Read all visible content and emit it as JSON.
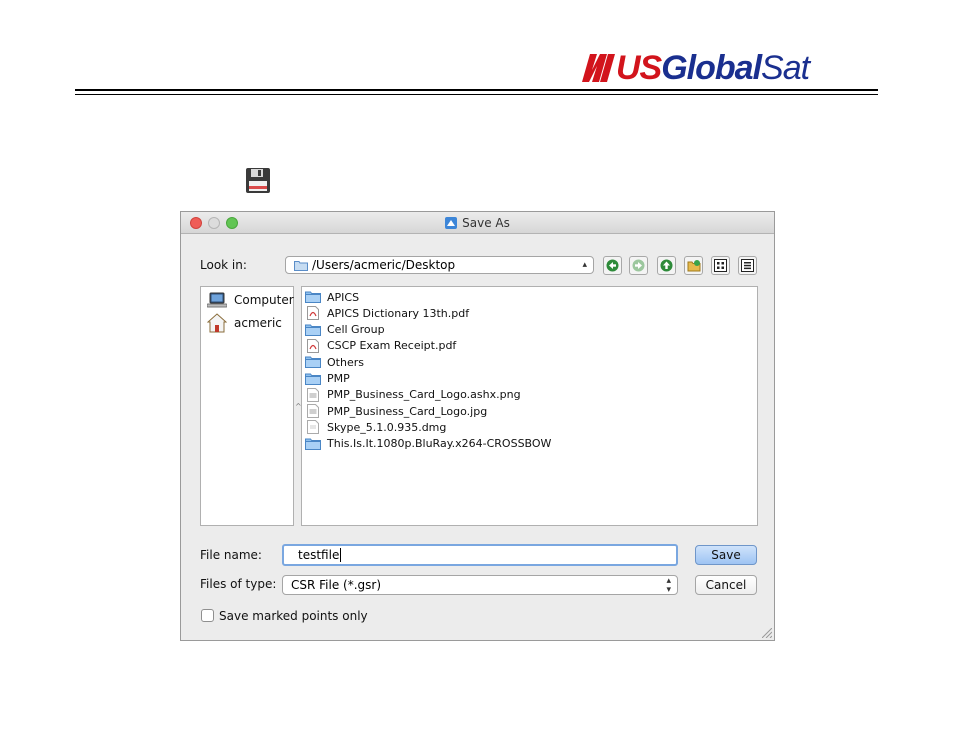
{
  "brand": {
    "logo_prefix": "US",
    "logo_suffix_1": "Global",
    "logo_suffix_2": "Sat",
    "colors": {
      "red": "#d2141c",
      "blue": "#1a2f8f"
    }
  },
  "page_icons": {
    "floppy": "floppy-disk-icon"
  },
  "dialog": {
    "title": "Save As",
    "title_icon": "save-as-icon",
    "window_buttons": [
      "close",
      "minimize",
      "zoom"
    ],
    "look_in_label": "Look in:",
    "look_in_value": "/Users/acmeric/Desktop",
    "toolbar_icons": [
      "back-icon",
      "forward-icon",
      "parent-folder-icon",
      "new-folder-icon",
      "list-view-icon",
      "detail-view-icon"
    ],
    "places": [
      {
        "label": "Computer",
        "icon": "computer-icon"
      },
      {
        "label": "acmeric",
        "icon": "home-icon"
      }
    ],
    "files": [
      {
        "name": "APICS",
        "icon": "folder-icon"
      },
      {
        "name": "APICS Dictionary 13th.pdf",
        "icon": "pdf-icon"
      },
      {
        "name": "Cell Group",
        "icon": "folder-icon"
      },
      {
        "name": "CSCP Exam Receipt.pdf",
        "icon": "pdf-icon"
      },
      {
        "name": "Others",
        "icon": "folder-icon"
      },
      {
        "name": "PMP",
        "icon": "folder-icon"
      },
      {
        "name": "PMP_Business_Card_Logo.ashx.png",
        "icon": "image-file-icon"
      },
      {
        "name": "PMP_Business_Card_Logo.jpg",
        "icon": "image-file-icon"
      },
      {
        "name": "Skype_5.1.0.935.dmg",
        "icon": "file-icon"
      },
      {
        "name": "This.Is.It.1080p.BluRay.x264-CROSSBOW",
        "icon": "folder-icon"
      }
    ],
    "file_name_label": "File name:",
    "file_name_value": "testfile",
    "file_type_label": "Files of type:",
    "file_type_value": "CSR File (*.gsr)",
    "save_label": "Save",
    "cancel_label": "Cancel",
    "checkbox_label": "Save marked points only",
    "checkbox_checked": false
  }
}
